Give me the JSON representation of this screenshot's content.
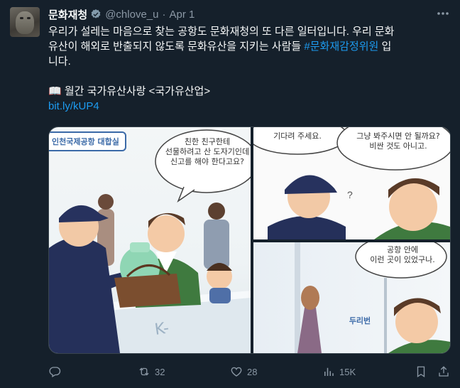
{
  "post": {
    "author_name": "문화재청",
    "handle": "@chlove_u",
    "separator": "·",
    "date": "Apr 1",
    "text_line1": "우리가 설레는 마음으로 찾는 공항도 문화재청의 또 다른 일터입니다. 우리 문화",
    "text_line2_pre": "유산이 해외로 반출되지 않도록 문화유산을 지키는 사람들 ",
    "hashtag": "#문화재감정위원",
    "text_line2_post": " 입",
    "text_line3": "니다.",
    "book_emoji": "📖",
    "magazine_line": " 월간 국가유산사랑 <국가유산업>",
    "short_link": "bit.ly/kUP4"
  },
  "comic": {
    "sign_text": "인천국제공항 대합실",
    "bubble1": "친한 친구한테\n선물하려고 산 도자기인데\n신고를 해야 한다고요?",
    "bubble2": "기다려 주세요.",
    "bubble3": "그냥 봐주시면 안 될까요?\n비싼 것도 아니고.",
    "bubble4": "공항 안에\n이런 곳이 있었구나.",
    "sfx": "두리번"
  },
  "metrics": {
    "replies": "",
    "reposts": "32",
    "likes": "28",
    "views": "15K"
  },
  "colors": {
    "background": "#15202b",
    "text": "#f7f9f9",
    "muted": "#8b98a5",
    "link": "#1d9bf0"
  },
  "icons": [
    "verified-badge-icon",
    "more-icon",
    "reply-icon",
    "repost-icon",
    "like-icon",
    "views-icon",
    "bookmark-icon",
    "share-icon"
  ]
}
